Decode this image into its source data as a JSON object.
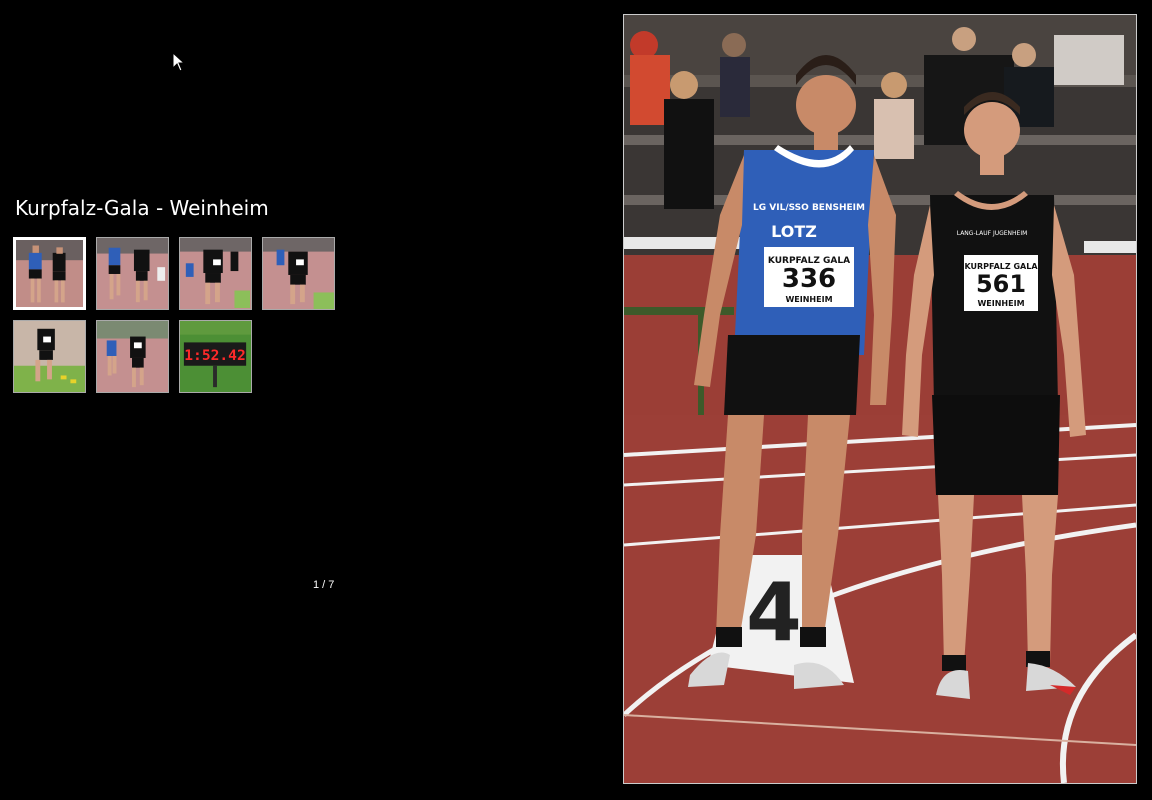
{
  "gallery": {
    "title": "Kurpfalz-Gala - Weinheim",
    "counter": "1 / 7",
    "thumbnails": [
      {
        "name": "thumb-1",
        "active": true
      },
      {
        "name": "thumb-2",
        "active": false
      },
      {
        "name": "thumb-3",
        "active": false
      },
      {
        "name": "thumb-4",
        "active": false
      },
      {
        "name": "thumb-5",
        "active": false
      },
      {
        "name": "thumb-6",
        "active": false
      },
      {
        "name": "thumb-7",
        "active": false
      }
    ],
    "clock_text": "1:52.42"
  },
  "photo": {
    "left_bib": "336",
    "right_bib": "561",
    "bib_header": "KURPFALZ GALA",
    "bib_footer": "WEINHEIM",
    "lane_number": "4",
    "left_club": "LG VIL/SSO BENSHEIM",
    "left_sponsor": "LOTZ",
    "right_club": "LANG-LAUF JUGENHEIM"
  },
  "colors": {
    "track": "#9b3e36",
    "blue_shirt": "#2f5fb8",
    "black_shirt": "#111111",
    "clock_red": "#ff2a2a"
  }
}
